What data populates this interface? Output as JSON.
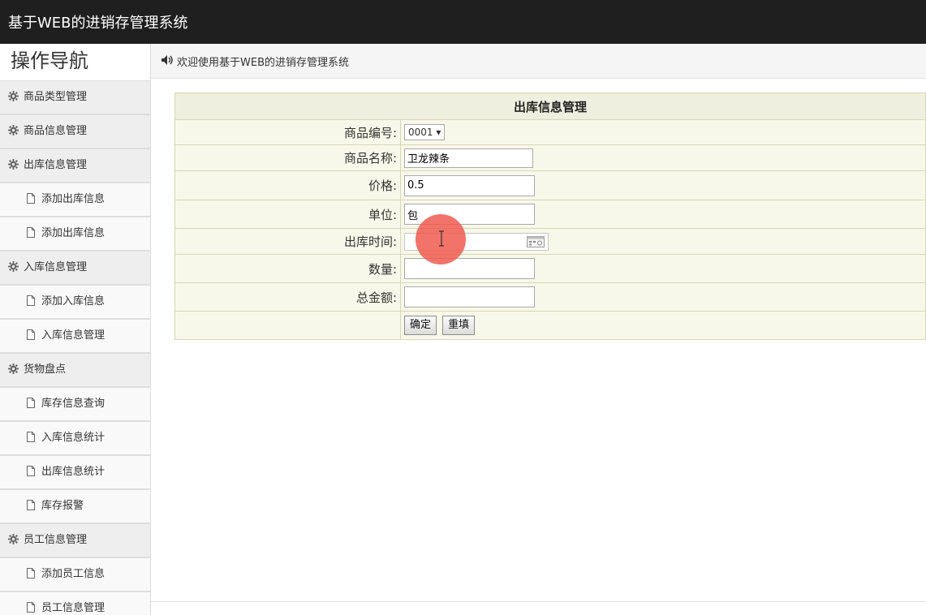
{
  "app": {
    "title": "基于WEB的进销存管理系统"
  },
  "sidebar": {
    "title": "操作导航",
    "items": [
      {
        "type": "group",
        "label": "商品类型管理",
        "icon": "gear-icon"
      },
      {
        "type": "group",
        "label": "商品信息管理",
        "icon": "gear-icon"
      },
      {
        "type": "group",
        "label": "出库信息管理",
        "icon": "gear-icon"
      },
      {
        "type": "item",
        "label": "添加出库信息",
        "icon": "document-icon"
      },
      {
        "type": "item",
        "label": "添加出库信息",
        "icon": "document-icon"
      },
      {
        "type": "group",
        "label": "入库信息管理",
        "icon": "gear-icon"
      },
      {
        "type": "item",
        "label": "添加入库信息",
        "icon": "document-icon"
      },
      {
        "type": "item",
        "label": "入库信息管理",
        "icon": "document-icon"
      },
      {
        "type": "group",
        "label": "货物盘点",
        "icon": "gear-icon"
      },
      {
        "type": "item",
        "label": "库存信息查询",
        "icon": "document-icon"
      },
      {
        "type": "item",
        "label": "入库信息统计",
        "icon": "document-icon"
      },
      {
        "type": "item",
        "label": "出库信息统计",
        "icon": "document-icon"
      },
      {
        "type": "item",
        "label": "库存报警",
        "icon": "document-icon"
      },
      {
        "type": "group",
        "label": "员工信息管理",
        "icon": "gear-icon"
      },
      {
        "type": "item",
        "label": "添加员工信息",
        "icon": "document-icon"
      },
      {
        "type": "item",
        "label": "员工信息管理",
        "icon": "document-icon"
      }
    ]
  },
  "breadcrumb": {
    "text": "欢迎使用基于WEB的进销存管理系统",
    "icon": "speaker-icon"
  },
  "form": {
    "title": "出库信息管理",
    "product_code": {
      "label": "商品编号:",
      "value": "0001 ▾"
    },
    "product_name": {
      "label": "商品名称:",
      "value": "卫龙辣条"
    },
    "price": {
      "label": "价格:",
      "value": "0.5"
    },
    "unit": {
      "label": "单位:",
      "value": "包"
    },
    "out_time": {
      "label": "出库时间:",
      "value": ""
    },
    "quantity": {
      "label": "数量:",
      "value": ""
    },
    "total": {
      "label": "总金额:",
      "value": ""
    },
    "confirm_label": "确定",
    "reset_label": "重填"
  },
  "colors": {
    "topbar": "#1f1f1f",
    "form_bg": "#f8f8ea",
    "form_border": "#d8d6b6",
    "cursor_highlight": "#f05a50"
  }
}
